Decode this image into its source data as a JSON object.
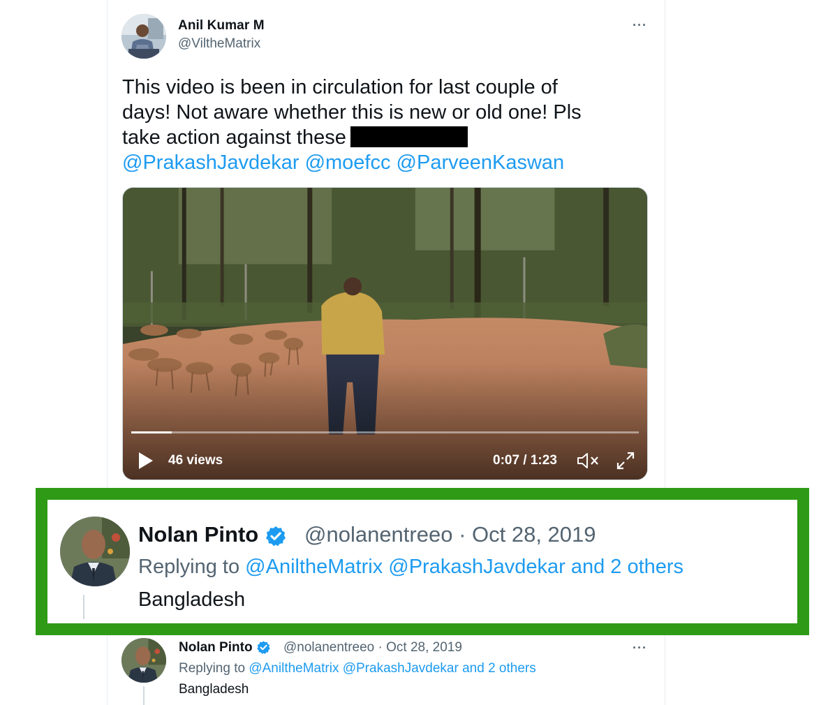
{
  "main_tweet": {
    "author_name": "Anil Kumar M",
    "author_handle": "@ViltheMatrix",
    "more_label": "···",
    "text_line1": "This video is been in circulation for last couple of",
    "text_line2": "days! Not aware whether this is new or old one! Pls",
    "text_line3": "take action against these",
    "mentions": [
      "@PrakashJavdekar",
      "@moefcc",
      "@ParveenKaswan"
    ],
    "video": {
      "views": "46 views",
      "time": "0:07 / 1:23",
      "progress": 0.08
    }
  },
  "highlighted_reply": {
    "author_name": "Nolan Pinto",
    "handle_and_date": "@nolanentreeo · Oct 28, 2019",
    "replying_prefix": "Replying to",
    "replying_mentions": "@AniltheMatrix @PrakashJavdekar and 2 others",
    "text": "Bangladesh",
    "frame_color": "#2f9a16"
  },
  "reply": {
    "author_name": "Nolan Pinto",
    "handle_and_date": "@nolanentreeo · Oct 28, 2019",
    "replying_prefix": "Replying to",
    "replying_mentions": "@AniltheMatrix @PrakashJavdekar and 2 others",
    "text": "Bangladesh",
    "more_label": "···"
  },
  "colors": {
    "link": "#1d9bf0",
    "verified": "#1d9bf0",
    "secondary_text": "#536471"
  },
  "icons": [
    "play-icon",
    "mute-icon",
    "expand-icon",
    "verified-icon",
    "more-icon"
  ]
}
